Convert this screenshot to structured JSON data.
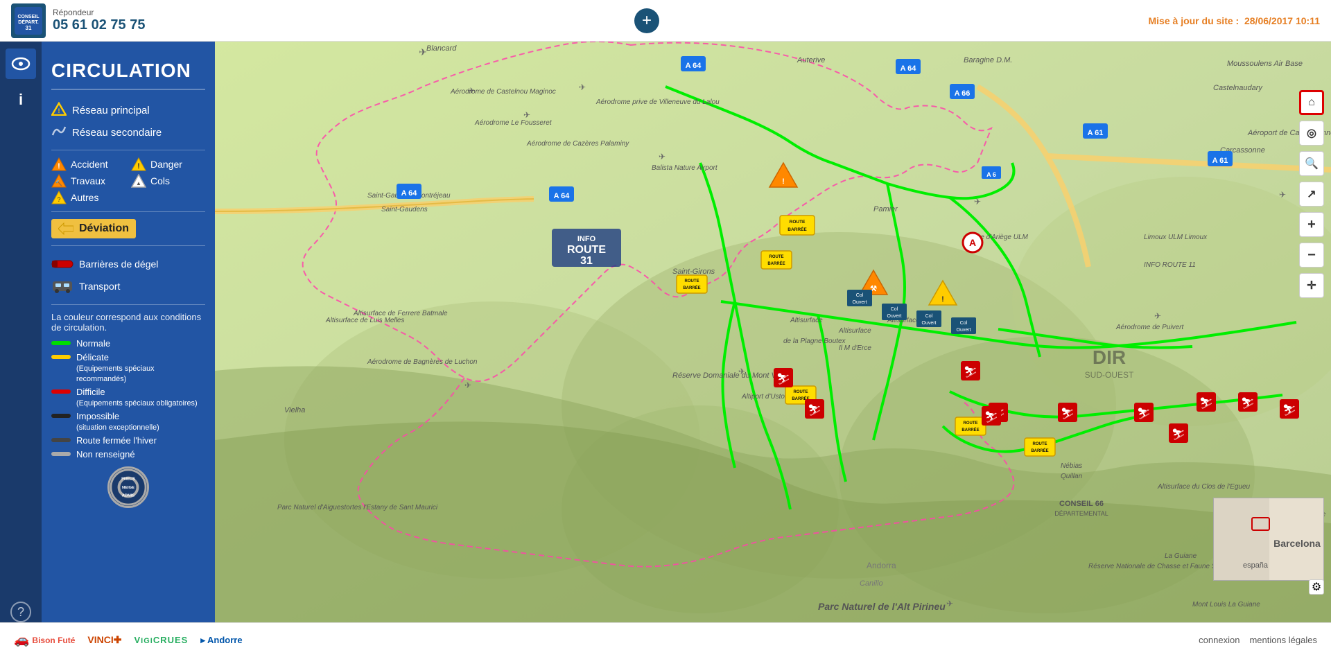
{
  "header": {
    "phone_label": "Répondeur",
    "phone_number": "05 61 02 75 75",
    "add_button_label": "+",
    "update_prefix": "Mise à jour du site :",
    "update_date": "28/06/2017 10:11"
  },
  "sidebar": {
    "title": "CIRCULATION",
    "menu_items": [
      {
        "label": "Réseau principal",
        "icon": "warning-triangle"
      },
      {
        "label": "Réseau secondaire",
        "icon": "road-squiggle"
      }
    ],
    "legend_items": [
      {
        "label": "Accident",
        "icon": "accident"
      },
      {
        "label": "Danger",
        "icon": "danger"
      },
      {
        "label": "Travaux",
        "icon": "travaux"
      },
      {
        "label": "Cols",
        "icon": "cols"
      },
      {
        "label": "Autres",
        "icon": "autres"
      }
    ],
    "deviation_label": "Déviation",
    "barriere_label": "Barrières de dégel",
    "transport_label": "Transport",
    "color_legend_text": "La couleur correspond aux conditions de circulation.",
    "colors": [
      {
        "label": "Normale",
        "type": "green"
      },
      {
        "label": "Délicate\n(Equipements spéciaux recommandés)",
        "type": "yellow"
      },
      {
        "label": "Difficile\n(Equipements spéciaux obligatoires)",
        "type": "red"
      },
      {
        "label": "Impossible\n(situation exceptionnelle)",
        "type": "black"
      },
      {
        "label": "Route fermée l'hiver",
        "type": "dark-gray"
      },
      {
        "label": "Non renseigné",
        "type": "light-gray"
      }
    ],
    "pneus_badge": "PNEUS\nNEIGE\nADMIS"
  },
  "map": {
    "info_route_31": "INFO\nROUTE 31",
    "info_route_11": "INFO\nROUTE 11",
    "dir_label": "DIR\nSUD-OUEST",
    "conseil66": "CONSEIL 66\nDÉPARTEMENTAL"
  },
  "right_controls": [
    {
      "label": "⌂",
      "name": "home-control",
      "active_red": true
    },
    {
      "label": "⊕",
      "name": "locate-control"
    },
    {
      "label": "🔍",
      "name": "search-control"
    },
    {
      "label": "↗",
      "name": "fullscreen-control"
    },
    {
      "label": "+",
      "name": "zoom-in-control"
    },
    {
      "label": "−",
      "name": "zoom-out-control"
    },
    {
      "label": "✛",
      "name": "layers-control"
    }
  ],
  "footer": {
    "logos": [
      {
        "label": "🚗 Bison Futé",
        "name": "bison-fute-logo"
      },
      {
        "label": "VINCI ✚",
        "name": "vinci-logo"
      },
      {
        "label": "VIGICRUES",
        "name": "vigicrues-logo"
      },
      {
        "label": "▸ Andorre",
        "name": "andorre-logo"
      }
    ],
    "links": [
      {
        "label": "connexion",
        "href": "#"
      },
      {
        "label": "mentions légales",
        "href": "#"
      }
    ]
  }
}
